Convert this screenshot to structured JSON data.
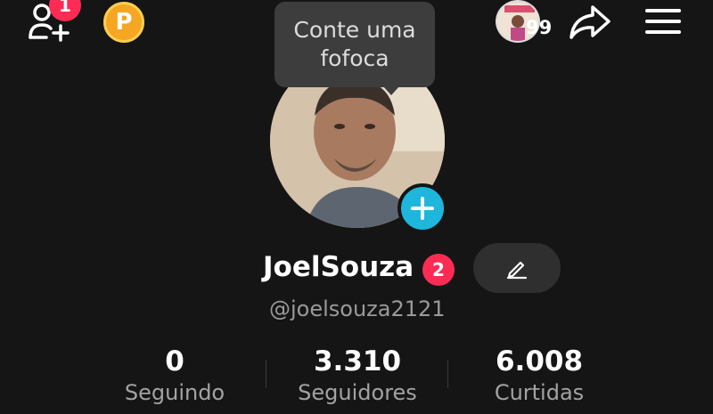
{
  "topbar": {
    "add_friend_icon": "add-user-icon",
    "add_friend_badge": "1",
    "coin_label": "P",
    "mini_avatar_count": "99",
    "share_icon": "share-arrow-icon",
    "menu_icon": "hamburger-menu-icon"
  },
  "tooltip": {
    "text": "Conte uma fofoca"
  },
  "profile": {
    "avatar_icon": "profile-photo",
    "add_button_icon": "plus-icon",
    "username": "JoelSouza",
    "notification_badge": "2",
    "edit_icon": "pencil-icon",
    "handle": "@joelsouza2121"
  },
  "stats": [
    {
      "value": "0",
      "label": "Seguindo"
    },
    {
      "value": "3.310",
      "label": "Seguidores"
    },
    {
      "value": "6.008",
      "label": "Curtidas"
    }
  ],
  "colors": {
    "background": "#151515",
    "badge": "#fe2c55",
    "coin": "#f5a623",
    "plus": "#1fb6dc"
  }
}
